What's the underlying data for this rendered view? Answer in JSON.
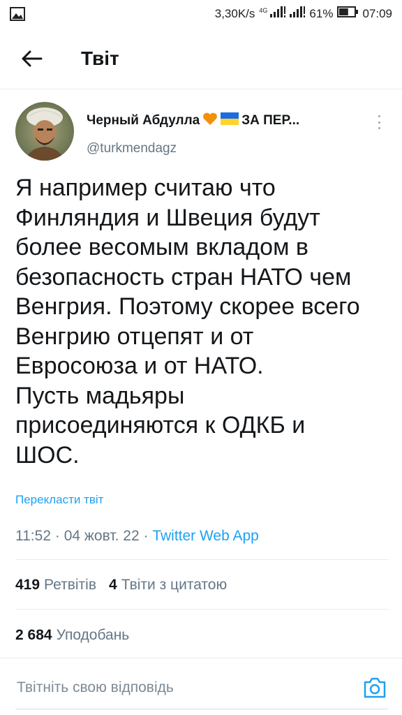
{
  "status_bar": {
    "speed": "3,30K/s",
    "network": "4G",
    "battery_percent": "61%",
    "battery_level": 0.61,
    "time": "07:09"
  },
  "header": {
    "title": "Твіт",
    "back_icon": "arrow-left-icon"
  },
  "tweet": {
    "display_name": "Черный Абдулла",
    "display_name_suffix": "ЗА ПЕР...",
    "name_emojis": [
      "orange-heart-icon",
      "ukraine-flag-icon"
    ],
    "handle": "@turkmendagz",
    "text_lines": [
      "Я например считаю что",
      "Финляндия и Швеция будут",
      "более весомым вкладом в",
      "безопасность стран НАТО чем",
      "Венгрия. Поэтому скорее всего",
      "Венгрию отцепят и от",
      "Евросоюза и от НАТО.",
      "Пусть мадьяры",
      "присоединяются к ОДКБ и",
      "ШОС."
    ],
    "translate_label": "Перекласти твіт",
    "time": "11:52",
    "separator": "·",
    "date": "04 жовт. 22",
    "source": "Twitter Web App"
  },
  "stats": {
    "retweets_count": "419",
    "retweets_label": "Ретвітів",
    "quotes_count": "4",
    "quotes_label": "Твіти з цитатою",
    "likes_count": "2 684",
    "likes_label": "Уподобань"
  },
  "reply": {
    "placeholder": "Твітніть свою відповідь",
    "camera_icon": "camera-icon"
  },
  "colors": {
    "accent": "#1da1f2",
    "secondary_text": "#657786",
    "primary_text": "#14171a",
    "divider": "#e6ecf0"
  }
}
